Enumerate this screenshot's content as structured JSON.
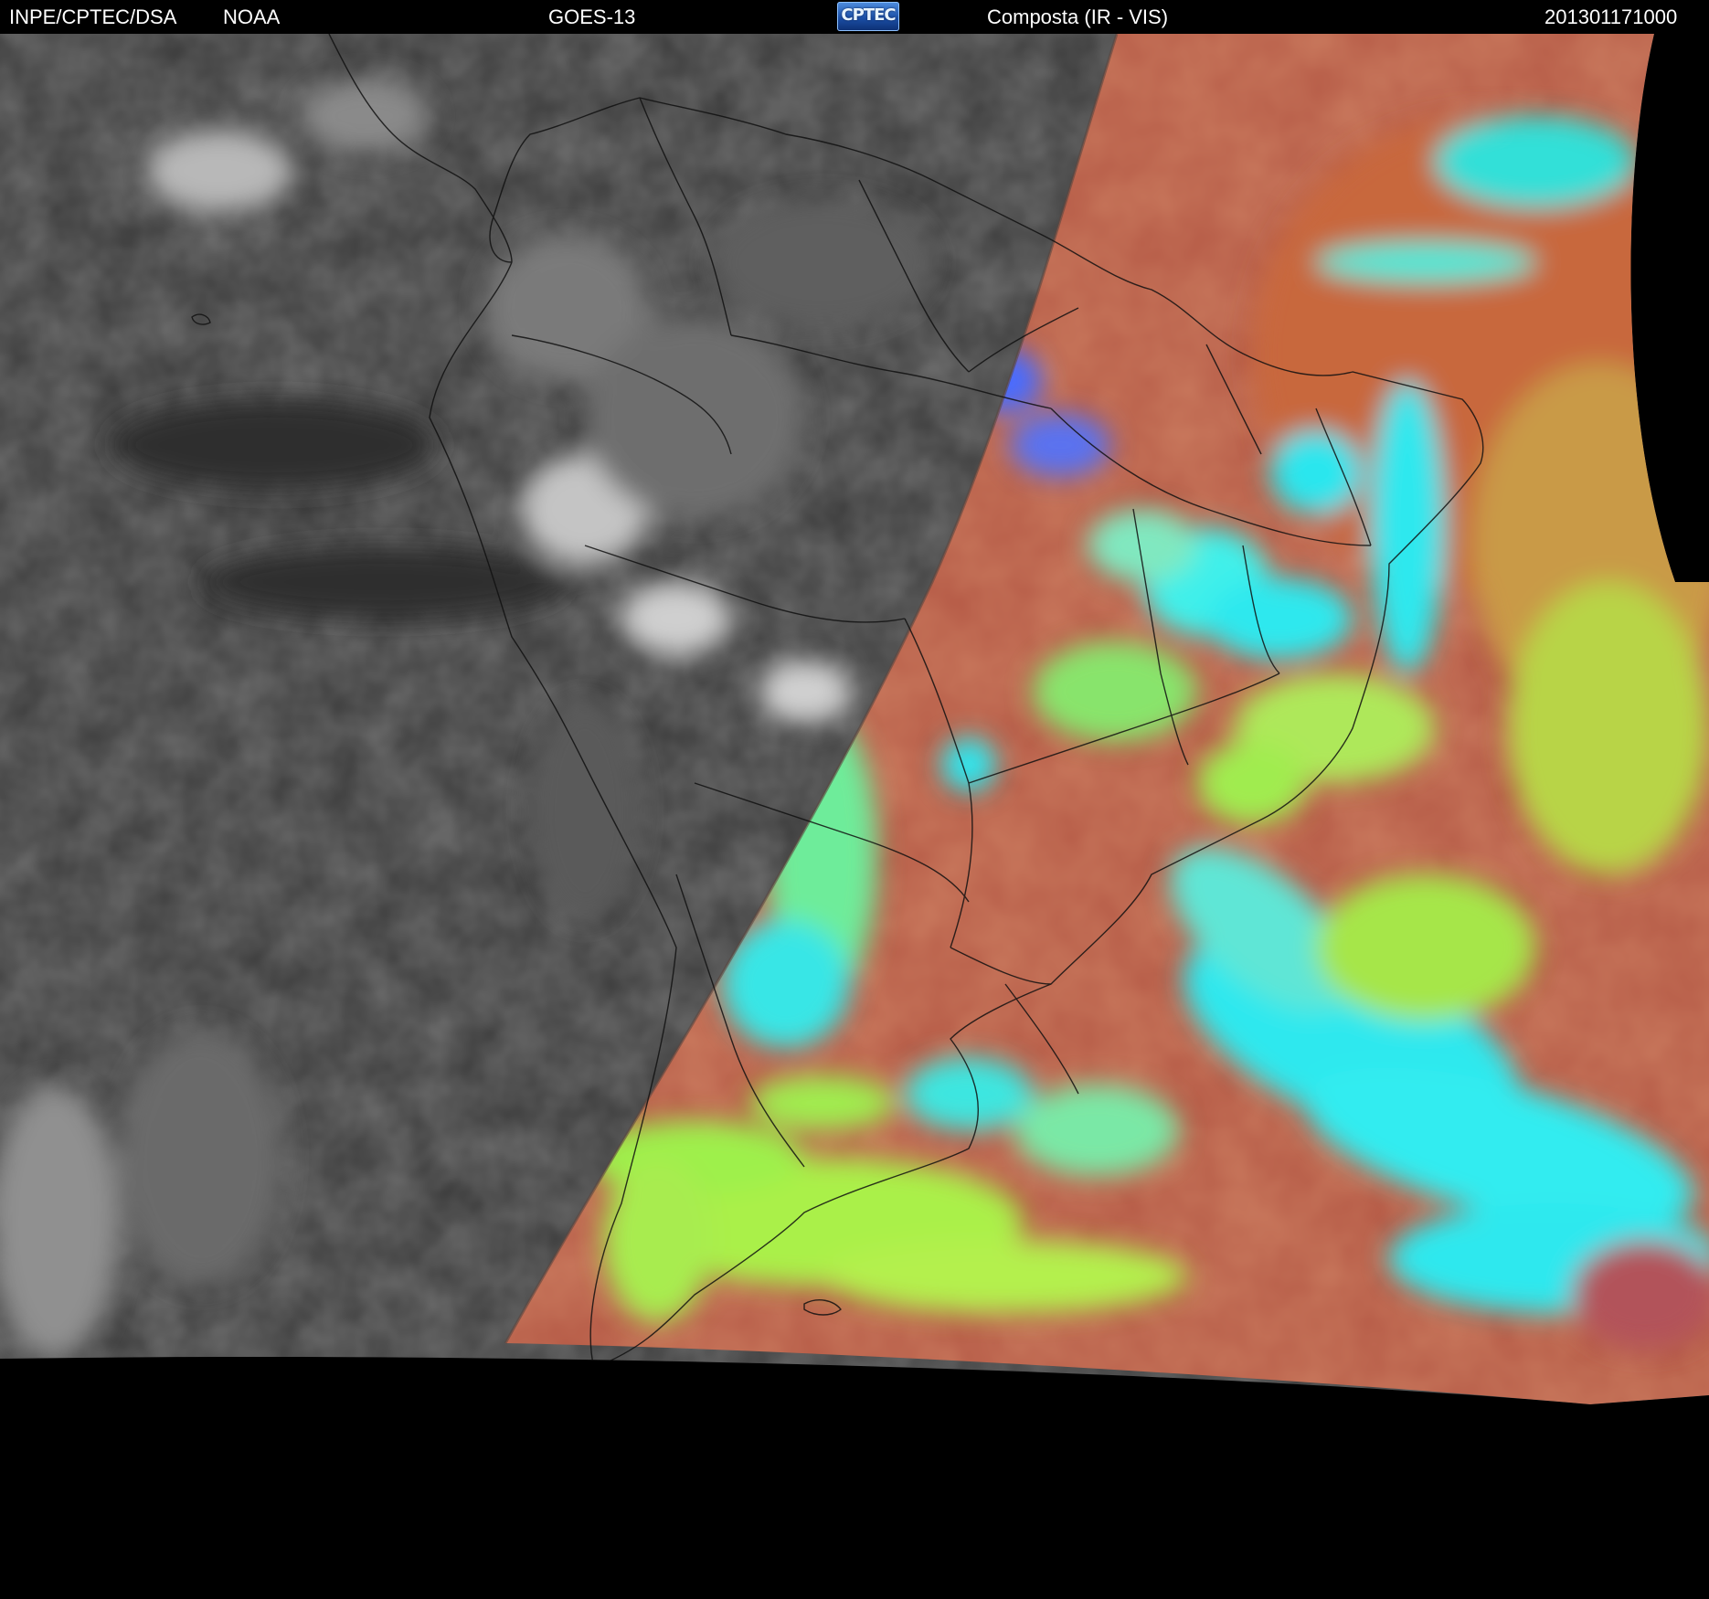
{
  "header": {
    "organization": "INPE/CPTEC/DSA",
    "agency": "NOAA",
    "satellite": "GOES-13",
    "logo_text": "CPTEC",
    "product": "Composta (IR - VIS)",
    "timestamp": "201301171000"
  },
  "colors": {
    "background": "#000000",
    "header_text": "#ffffff",
    "night_ir": "#3a3a3a",
    "day_land": "#b0524a",
    "day_ocean_warm": "#c96040",
    "cloud_cyan": "#1ee8e8",
    "cloud_green": "#a6f04a",
    "cloud_blue": "#4a6cff",
    "border_lines": "#111111"
  },
  "map": {
    "description_source": "GOES-13 full disk sector over South America, night side shown as IR grayscale, day side shown as IR-VIS color composite"
  }
}
